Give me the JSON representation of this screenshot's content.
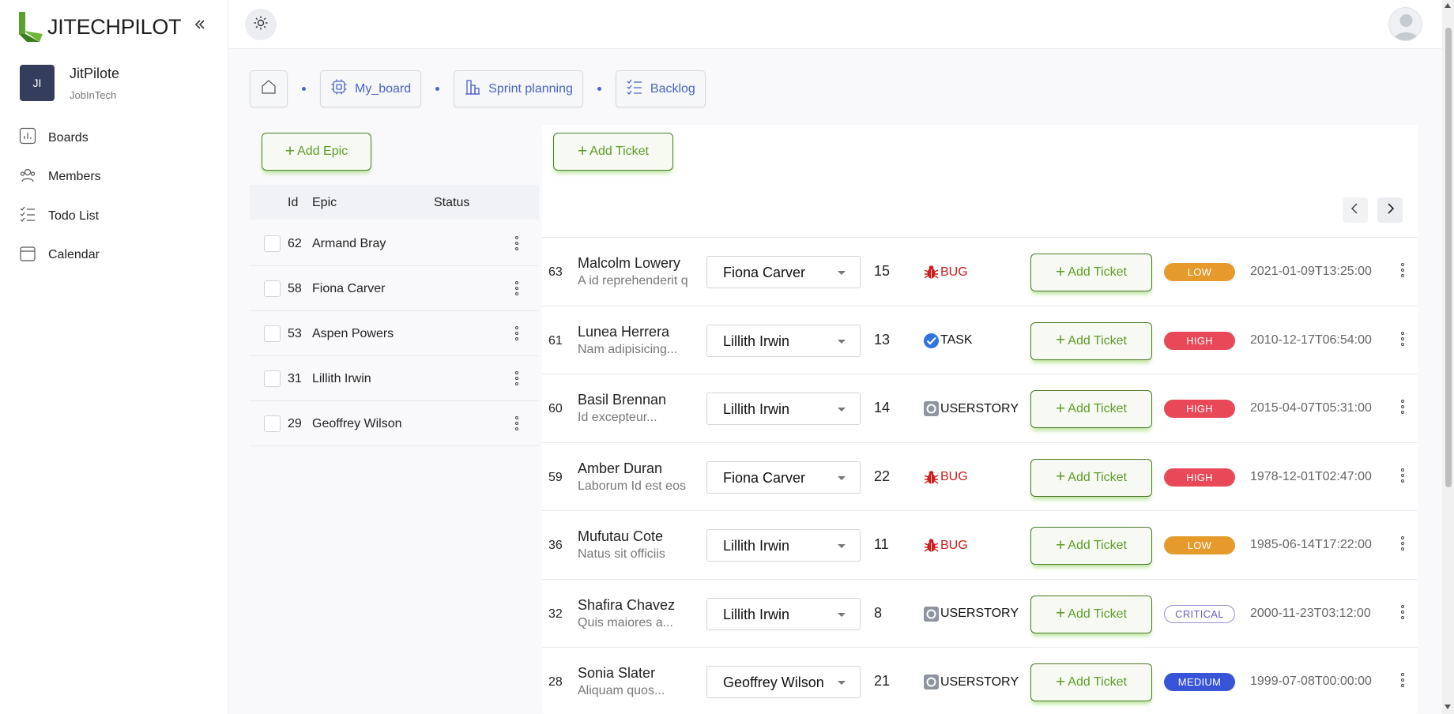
{
  "app": {
    "name": "JITECHPILOT"
  },
  "colors": {
    "brand_green": "#5f9a2a",
    "link_blue": "#4c62c8",
    "low": "#e59a2b",
    "high": "#e84857",
    "medium": "#3854d9",
    "critical": "#6c5fb8",
    "bug": "#d11a1a"
  },
  "account": {
    "initials": "JI",
    "name": "JitPilote",
    "org": "JobInTech"
  },
  "nav": [
    {
      "label": "Boards",
      "icon": "bar-chart-icon"
    },
    {
      "label": "Members",
      "icon": "members-icon"
    },
    {
      "label": "Todo List",
      "icon": "checklist-icon"
    },
    {
      "label": "Calendar",
      "icon": "calendar-icon"
    }
  ],
  "breadcrumbs": [
    {
      "label": "",
      "icon": "home-icon"
    },
    {
      "label": "My_board",
      "icon": "chip-icon"
    },
    {
      "label": "Sprint planning",
      "icon": "building-icon"
    },
    {
      "label": "Backlog",
      "icon": "checklist-icon"
    }
  ],
  "epics": {
    "add_label": "Add Epic",
    "columns": {
      "id": "Id",
      "epic": "Epic",
      "status": "Status"
    },
    "rows": [
      {
        "id": "62",
        "name": "Armand Bray"
      },
      {
        "id": "58",
        "name": "Fiona Carver"
      },
      {
        "id": "53",
        "name": "Aspen Powers"
      },
      {
        "id": "31",
        "name": "Lillith Irwin"
      },
      {
        "id": "29",
        "name": "Geoffrey Wilson"
      }
    ]
  },
  "tickets": {
    "add_label": "Add Ticket",
    "rows": [
      {
        "id": "63",
        "name": "Malcolm Lowery",
        "desc": "A id reprehenderit q",
        "assignee": "Fiona Carver",
        "points": "15",
        "type": "BUG",
        "type_class": "bug",
        "action": "Add Ticket",
        "priority": "LOW",
        "priority_class": "low",
        "date": "2021-01-09T13:25:00"
      },
      {
        "id": "61",
        "name": "Lunea Herrera",
        "desc": "Nam adipisicing...",
        "assignee": "Lillith Irwin",
        "points": "13",
        "type": "TASK",
        "type_class": "task",
        "action": "Add Ticket",
        "priority": "HIGH",
        "priority_class": "high",
        "date": "2010-12-17T06:54:00"
      },
      {
        "id": "60",
        "name": "Basil Brennan",
        "desc": "Id excepteur...",
        "assignee": "Lillith Irwin",
        "points": "14",
        "type": "USERSTORY",
        "type_class": "story",
        "action": "Add Ticket",
        "priority": "HIGH",
        "priority_class": "high",
        "date": "2015-04-07T05:31:00"
      },
      {
        "id": "59",
        "name": "Amber Duran",
        "desc": "Laborum Id est eos",
        "assignee": "Fiona Carver",
        "points": "22",
        "type": "BUG",
        "type_class": "bug",
        "action": "Add Ticket",
        "priority": "HIGH",
        "priority_class": "high",
        "date": "1978-12-01T02:47:00"
      },
      {
        "id": "36",
        "name": "Mufutau Cote",
        "desc": "Natus sit officiis",
        "assignee": "Lillith Irwin",
        "points": "11",
        "type": "BUG",
        "type_class": "bug",
        "action": "Add Ticket",
        "priority": "LOW",
        "priority_class": "low",
        "date": "1985-06-14T17:22:00"
      },
      {
        "id": "32",
        "name": "Shafira Chavez",
        "desc": "Quis maiores a...",
        "assignee": "Lillith Irwin",
        "points": "8",
        "type": "USERSTORY",
        "type_class": "story",
        "action": "Add Ticket",
        "priority": "CRITICAL",
        "priority_class": "critical",
        "date": "2000-11-23T03:12:00"
      },
      {
        "id": "28",
        "name": "Sonia Slater",
        "desc": "Aliquam quos...",
        "assignee": "Geoffrey Wilson",
        "points": "21",
        "type": "USERSTORY",
        "type_class": "story",
        "action": "Add Ticket",
        "priority": "MEDIUM",
        "priority_class": "medium",
        "date": "1999-07-08T00:00:00"
      }
    ]
  }
}
